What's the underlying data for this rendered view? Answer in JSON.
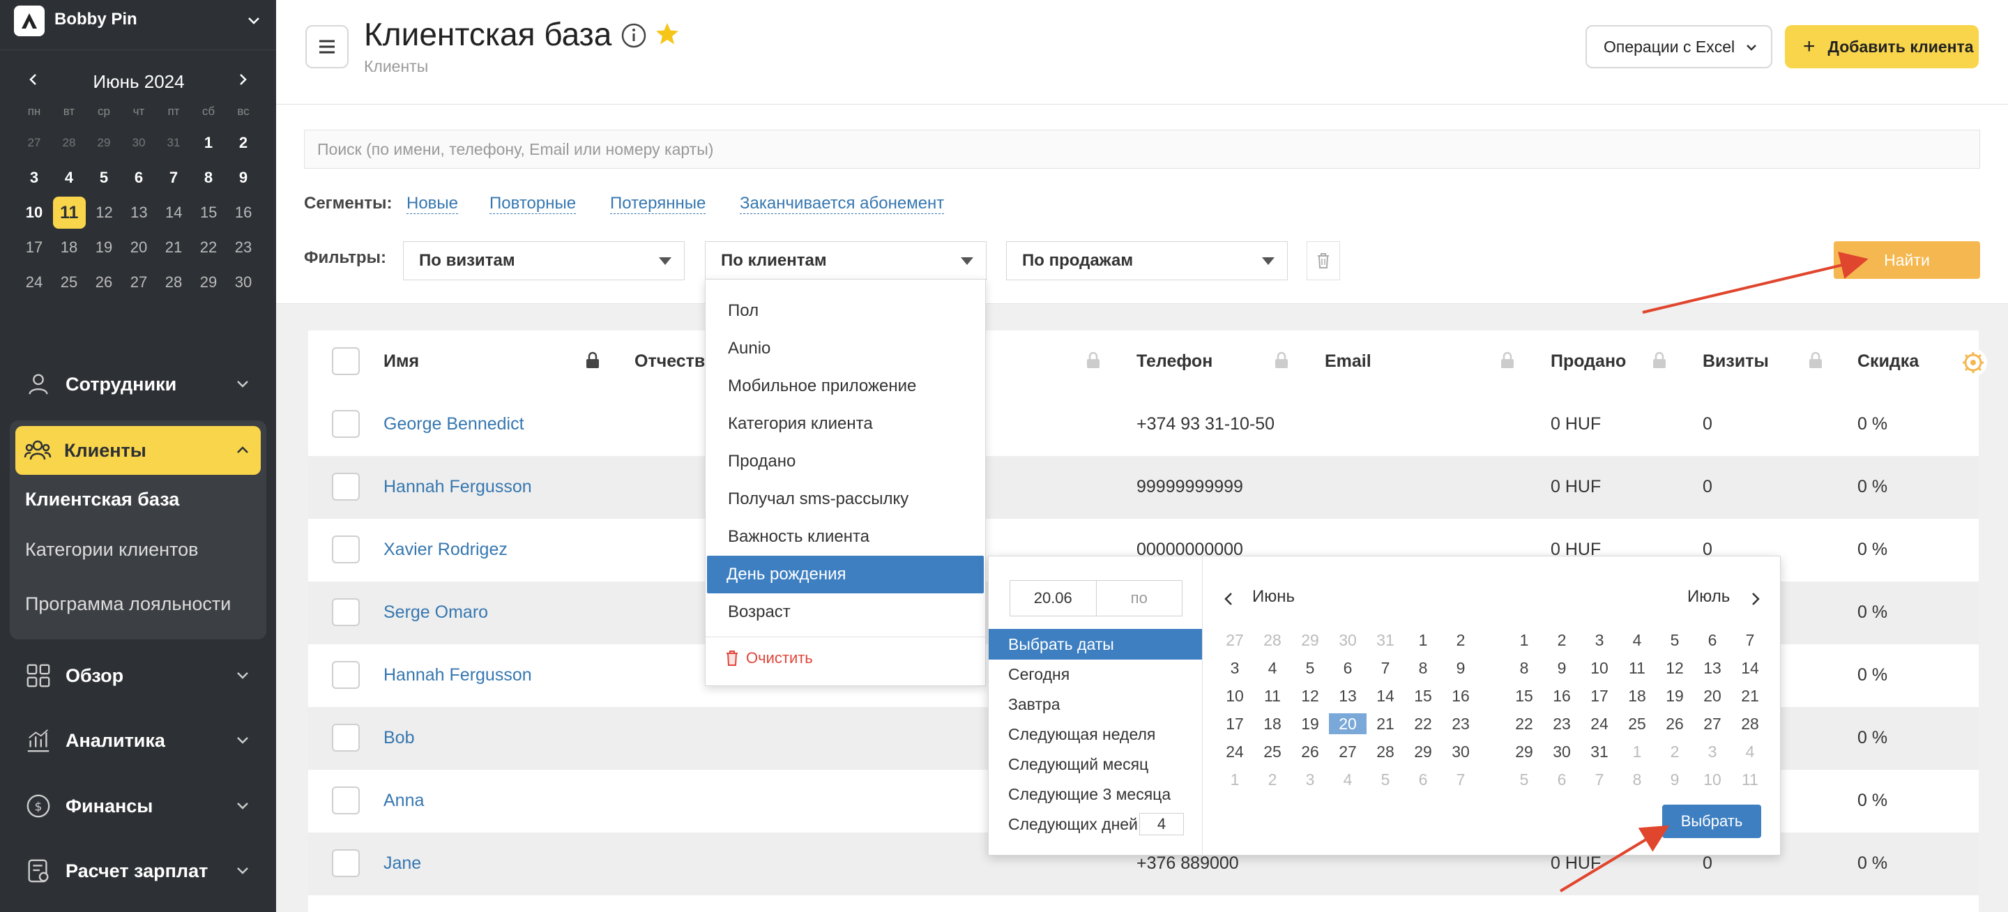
{
  "sidebar": {
    "user": "Bobby Pin",
    "calendar": {
      "title": "Июнь 2024",
      "weekdays": [
        "пн",
        "вт",
        "ср",
        "чт",
        "пт",
        "сб",
        "вс"
      ],
      "rows": [
        [
          "27",
          "28",
          "29",
          "30",
          "31",
          "1",
          "2"
        ],
        [
          "3",
          "4",
          "5",
          "6",
          "7",
          "8",
          "9"
        ],
        [
          "10",
          "11",
          "12",
          "13",
          "14",
          "15",
          "16"
        ],
        [
          "17",
          "18",
          "19",
          "20",
          "21",
          "22",
          "23"
        ],
        [
          "24",
          "25",
          "26",
          "27",
          "28",
          "29",
          "30"
        ]
      ]
    },
    "nav": {
      "staff": "Сотрудники",
      "clients": "Клиенты",
      "client_base": "Клиентская база",
      "client_categories": "Категории клиентов",
      "loyalty": "Программа лояльности",
      "overview": "Обзор",
      "analytics": "Аналитика",
      "finance": "Финансы",
      "payroll": "Расчет зарплат"
    },
    "accent": "#f8d54b"
  },
  "header": {
    "title": "Клиентская база",
    "breadcrumb": "Клиенты",
    "excel_button": "Операции с Excel",
    "add_button": "Добавить клиента",
    "add_icon": "+"
  },
  "filters": {
    "search_placeholder": "Поиск (по имени, телефону, Email или номеру карты)",
    "segments_label": "Сегменты:",
    "segments": [
      "Новые",
      "Повторные",
      "Потерянные",
      "Заканчивается абонемент"
    ],
    "filters_label": "Фильтры:",
    "by_visits": "По визитам",
    "by_clients": "По клиентам",
    "by_sales": "По продажам",
    "find_button": "Найти"
  },
  "dropdown": {
    "items": [
      "Пол",
      "Aunio",
      "Мобильное приложение",
      "Категория клиента",
      "Продано",
      "Получал sms-рассылку",
      "Важность клиента",
      "День рождения",
      "Возраст"
    ],
    "active_index": 7,
    "clear": "Очистить"
  },
  "datepicker": {
    "from": "20.06",
    "to_placeholder": "по",
    "ranges": [
      "Выбрать даты",
      "Сегодня",
      "Завтра",
      "Следующая неделя",
      "Следующий месяц",
      "Следующие 3 месяца",
      "Следующих дней"
    ],
    "days_value": "4",
    "month_left": "Июнь",
    "month_right": "Июль",
    "left_rows": [
      [
        "27",
        "28",
        "29",
        "30",
        "31",
        "1",
        "2"
      ],
      [
        "3",
        "4",
        "5",
        "6",
        "7",
        "8",
        "9"
      ],
      [
        "10",
        "11",
        "12",
        "13",
        "14",
        "15",
        "16"
      ],
      [
        "17",
        "18",
        "19",
        "20",
        "21",
        "22",
        "23"
      ],
      [
        "24",
        "25",
        "26",
        "27",
        "28",
        "29",
        "30"
      ],
      [
        "1",
        "2",
        "3",
        "4",
        "5",
        "6",
        "7"
      ]
    ],
    "right_rows": [
      [
        "1",
        "2",
        "3",
        "4",
        "5",
        "6",
        "7"
      ],
      [
        "8",
        "9",
        "10",
        "11",
        "12",
        "13",
        "14"
      ],
      [
        "15",
        "16",
        "17",
        "18",
        "19",
        "20",
        "21"
      ],
      [
        "22",
        "23",
        "24",
        "25",
        "26",
        "27",
        "28"
      ],
      [
        "29",
        "30",
        "31",
        "1",
        "2",
        "3",
        "4"
      ],
      [
        "5",
        "6",
        "7",
        "8",
        "9",
        "10",
        "11"
      ]
    ],
    "select_button": "Выбрать"
  },
  "table": {
    "headers": {
      "name": "Имя",
      "patronymic": "Отчество",
      "phone": "Телефон",
      "email": "Email",
      "sold": "Продано",
      "visits": "Визиты",
      "discount": "Скидка"
    },
    "rows": [
      {
        "name": "George Bennedict",
        "phone": "+374 93 31-10-50",
        "sold": "0 HUF",
        "visits": "0",
        "discount": "0 %"
      },
      {
        "name": "Hannah Fergusson",
        "phone": "99999999999",
        "sold": "0 HUF",
        "visits": "0",
        "discount": "0 %"
      },
      {
        "name": "Xavier Rodrigez",
        "phone": "00000000000",
        "sold": "0 HUF",
        "visits": "0",
        "discount": "0 %"
      },
      {
        "name": "Serge Omaro",
        "phone": "",
        "sold": "",
        "visits": "",
        "discount": "0 %"
      },
      {
        "name": "Hannah Fergusson",
        "phone": "",
        "sold": "",
        "visits": "",
        "discount": "0 %"
      },
      {
        "name": "Bob",
        "phone": "",
        "sold": "",
        "visits": "",
        "discount": "0 %"
      },
      {
        "name": "Anna",
        "phone": "",
        "sold": "",
        "visits": "",
        "discount": "0 %"
      },
      {
        "name": "Jane",
        "phone": "+376 889000",
        "sold": "0 HUF",
        "visits": "0",
        "discount": "0 %"
      }
    ]
  },
  "colors": {
    "primary_blue": "#3d7fc1",
    "link": "#3677b0",
    "find_button": "#f5b74f",
    "arrow": "#e0452d"
  }
}
